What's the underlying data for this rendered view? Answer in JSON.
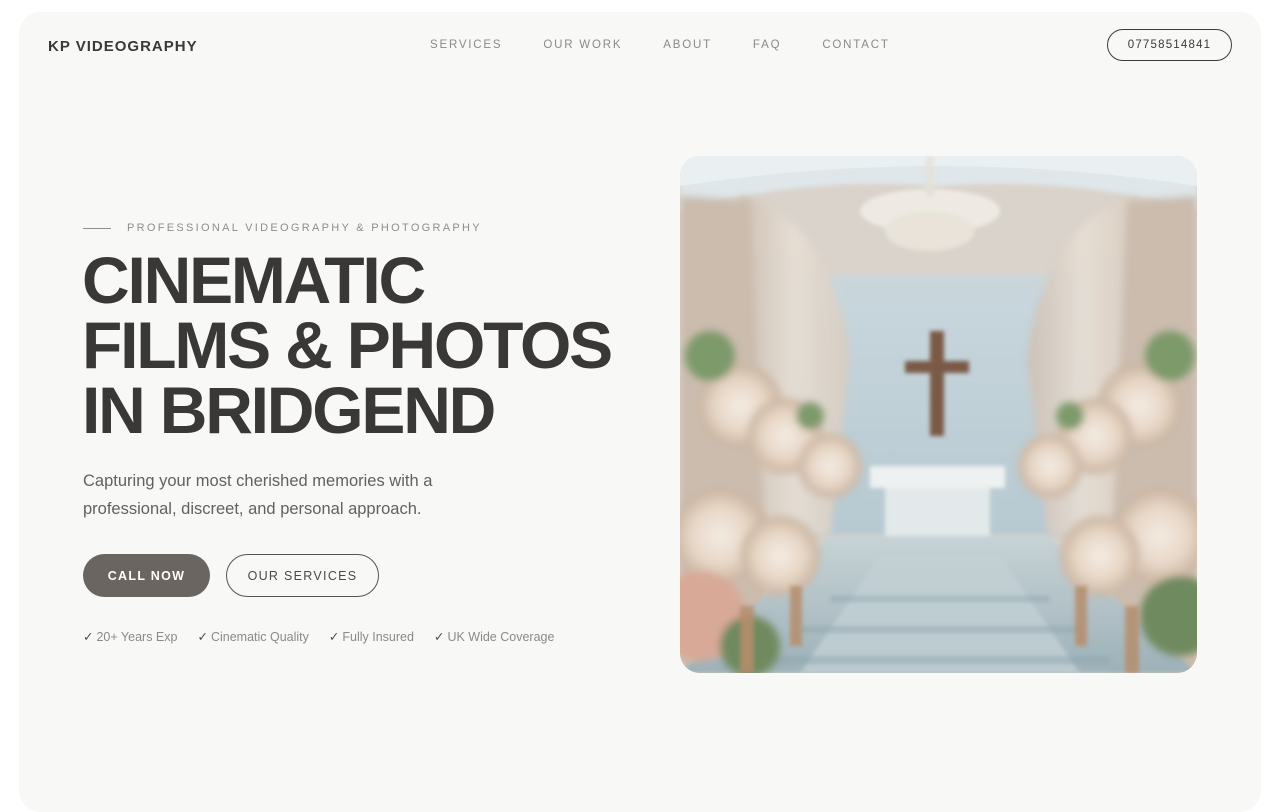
{
  "header": {
    "brand": "KP VIDEOGRAPHY",
    "nav": [
      "SERVICES",
      "OUR WORK",
      "ABOUT",
      "FAQ",
      "CONTACT"
    ],
    "phone": "07758514841"
  },
  "hero": {
    "eyebrow": "PROFESSIONAL VIDEOGRAPHY & PHOTOGRAPHY",
    "headline": [
      "CINEMATIC",
      "FILMS & PHOTOS",
      "IN BRIDGEND"
    ],
    "subtext": "Capturing your most cherished memories with a professional, discreet, and personal approach.",
    "cta_primary": "CALL NOW",
    "cta_secondary": "OUR SERVICES",
    "features": [
      {
        "check": "✓",
        "label": "20+ Years Exp"
      },
      {
        "check": "✓",
        "label": "Cinematic Quality"
      },
      {
        "check": "✓",
        "label": "Fully Insured"
      },
      {
        "check": "✓",
        "label": "UK Wide Coverage"
      }
    ]
  },
  "colors": {
    "page_bg": "#f8f8f6",
    "text_dark": "#393836",
    "text_muted": "#8b8a87",
    "button_primary": "#6a6560"
  }
}
